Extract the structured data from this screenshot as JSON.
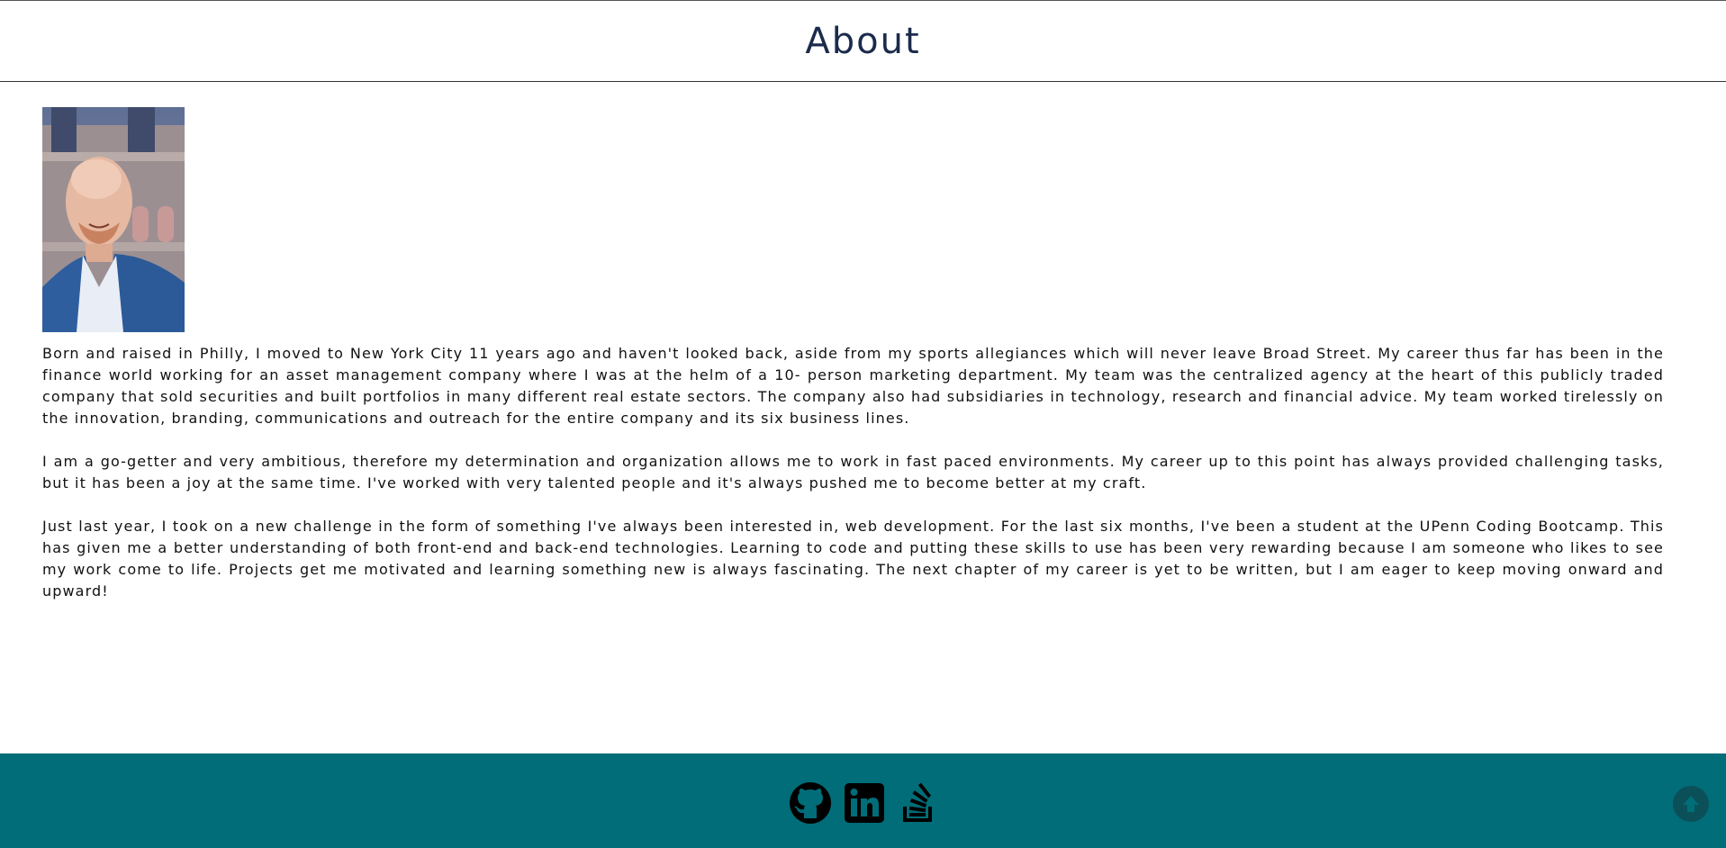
{
  "header": {
    "title": "About"
  },
  "profile": {
    "photo_alt": "Portrait photo"
  },
  "about": {
    "paragraphs": [
      "Born and raised in Philly, I moved to New York City 11 years ago and haven't looked back, aside from my sports allegiances which will never leave Broad Street. My career thus far has been in the finance world working for an asset management company where I was at the helm of a 10- person marketing department. My team was the centralized agency at the heart of this publicly traded company that sold securities and built portfolios in many different real estate sectors. The company also had subsidiaries in technology, research and financial advice. My team worked tirelessly on the innovation, branding, communications and outreach for the entire company and its six business lines.",
      "I am a go-getter and very ambitious, therefore my determination and organization allows me to work in fast paced environments. My career up to this point has always provided challenging tasks, but it has been a joy at the same time. I've worked with very talented people and it's always pushed me to become better at my craft.",
      "Just last year, I took on a new challenge in the form of something I've always been interested in, web development. For the last six months, I've been a student at the UPenn Coding Bootcamp. This has given me a better understanding of both front-end and back-end technologies. Learning to code and putting these skills to use has been very rewarding because I am someone who likes to see my work come to life. Projects get me motivated and learning something new is always fascinating. The next chapter of my career is yet to be written, but I am eager to keep moving onward and upward!"
    ]
  },
  "footer": {
    "background": "#006d78",
    "icons": [
      "github-icon",
      "linkedin-icon",
      "stack-overflow-icon"
    ],
    "back_to_top_icon": "arrow-up-circle-icon"
  }
}
